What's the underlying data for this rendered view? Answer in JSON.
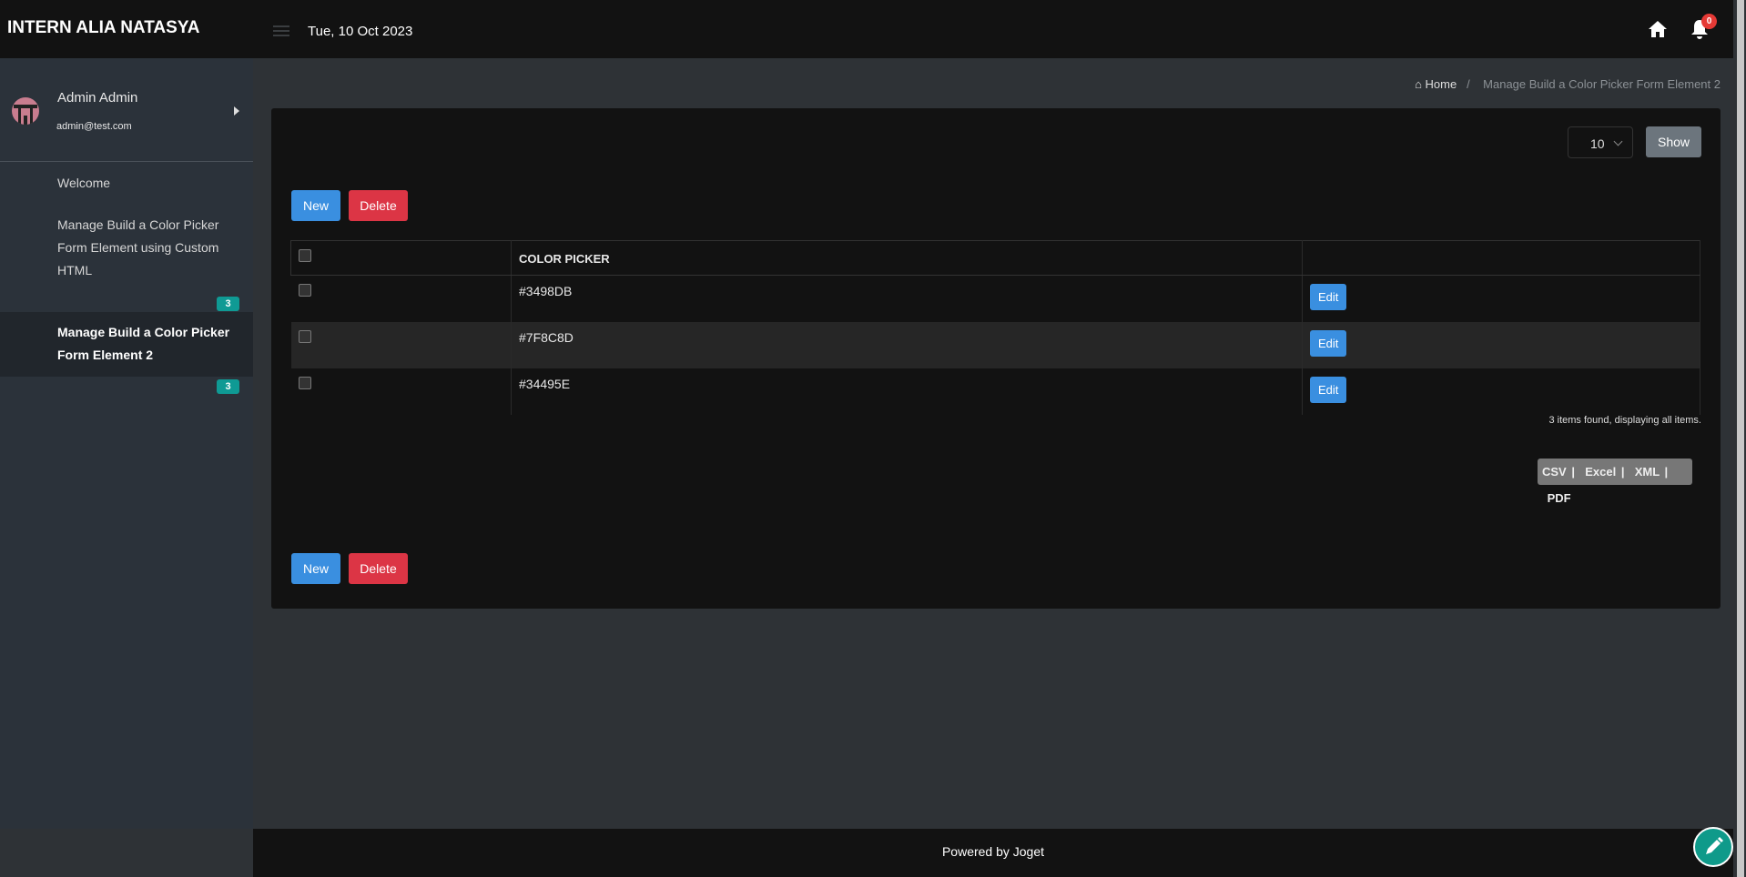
{
  "header": {
    "brand": "INTERN ALIA NATASYA",
    "date": "Tue, 10 Oct 2023",
    "notification_count": "0"
  },
  "user": {
    "name": "Admin Admin",
    "email": "admin@test.com"
  },
  "sidebar": {
    "items": [
      {
        "label": "Welcome"
      },
      {
        "label": "Manage Build a Color Picker Form Element using Custom HTML",
        "count": "3"
      },
      {
        "label": "Manage Build a Color Picker Form Element 2",
        "count": "3",
        "active": true
      }
    ]
  },
  "breadcrumb": {
    "home": "Home",
    "separator": "/",
    "current": "Manage Build a Color Picker Form Element 2"
  },
  "list": {
    "page_size": "10",
    "show_label": "Show",
    "new_label": "New",
    "delete_label": "Delete",
    "columns": [
      "COLOR PICKER"
    ],
    "rows": [
      {
        "color": "#3498DB",
        "action": "Edit"
      },
      {
        "color": "#7F8C8D",
        "action": "Edit"
      },
      {
        "color": "#34495E",
        "action": "Edit"
      }
    ],
    "summary": "3 items found, displaying all items.",
    "export": [
      "CSV",
      "Excel",
      "XML",
      "PDF"
    ]
  },
  "footer": {
    "text": "Powered by Joget"
  }
}
